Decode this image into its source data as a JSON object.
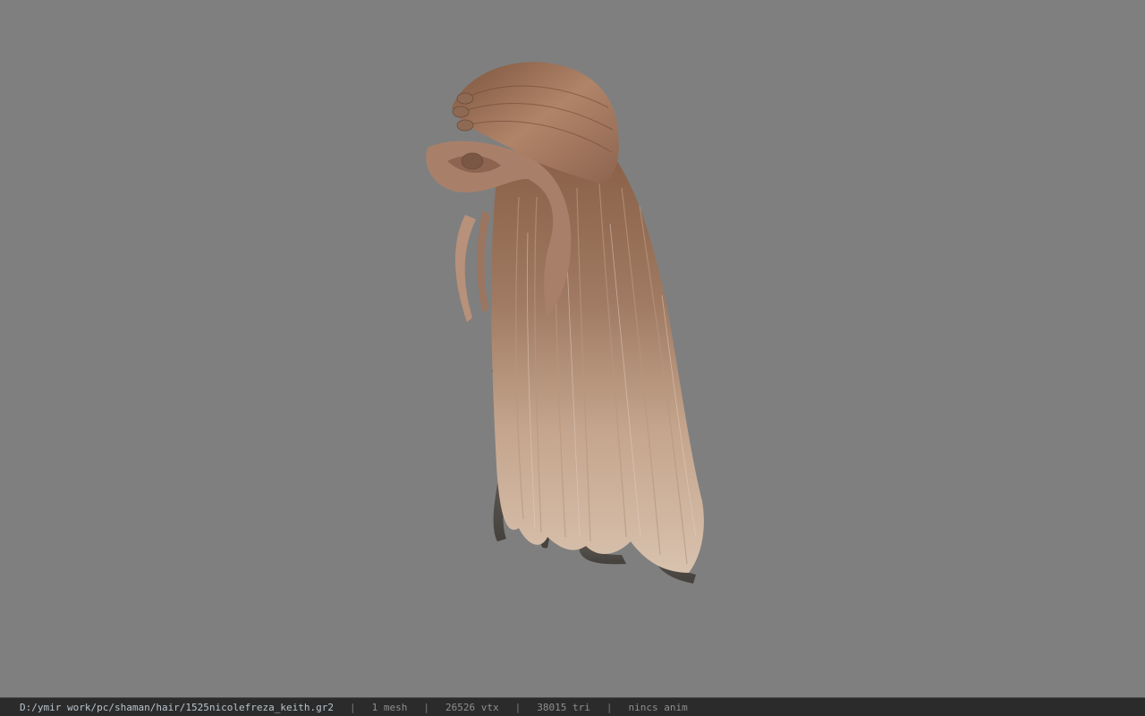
{
  "viewer": {
    "background_color": "#7f7f7f",
    "model_name": "hair"
  },
  "status_bar": {
    "file_path": "D:/ymir work/pc/shaman/hair/1525nicolefreza_keith.gr2",
    "separator": "|",
    "mesh_count": "1 mesh",
    "vertex_count": "26526 vtx",
    "triangle_count": "38015 tri",
    "anim_status": "nincs anim"
  }
}
